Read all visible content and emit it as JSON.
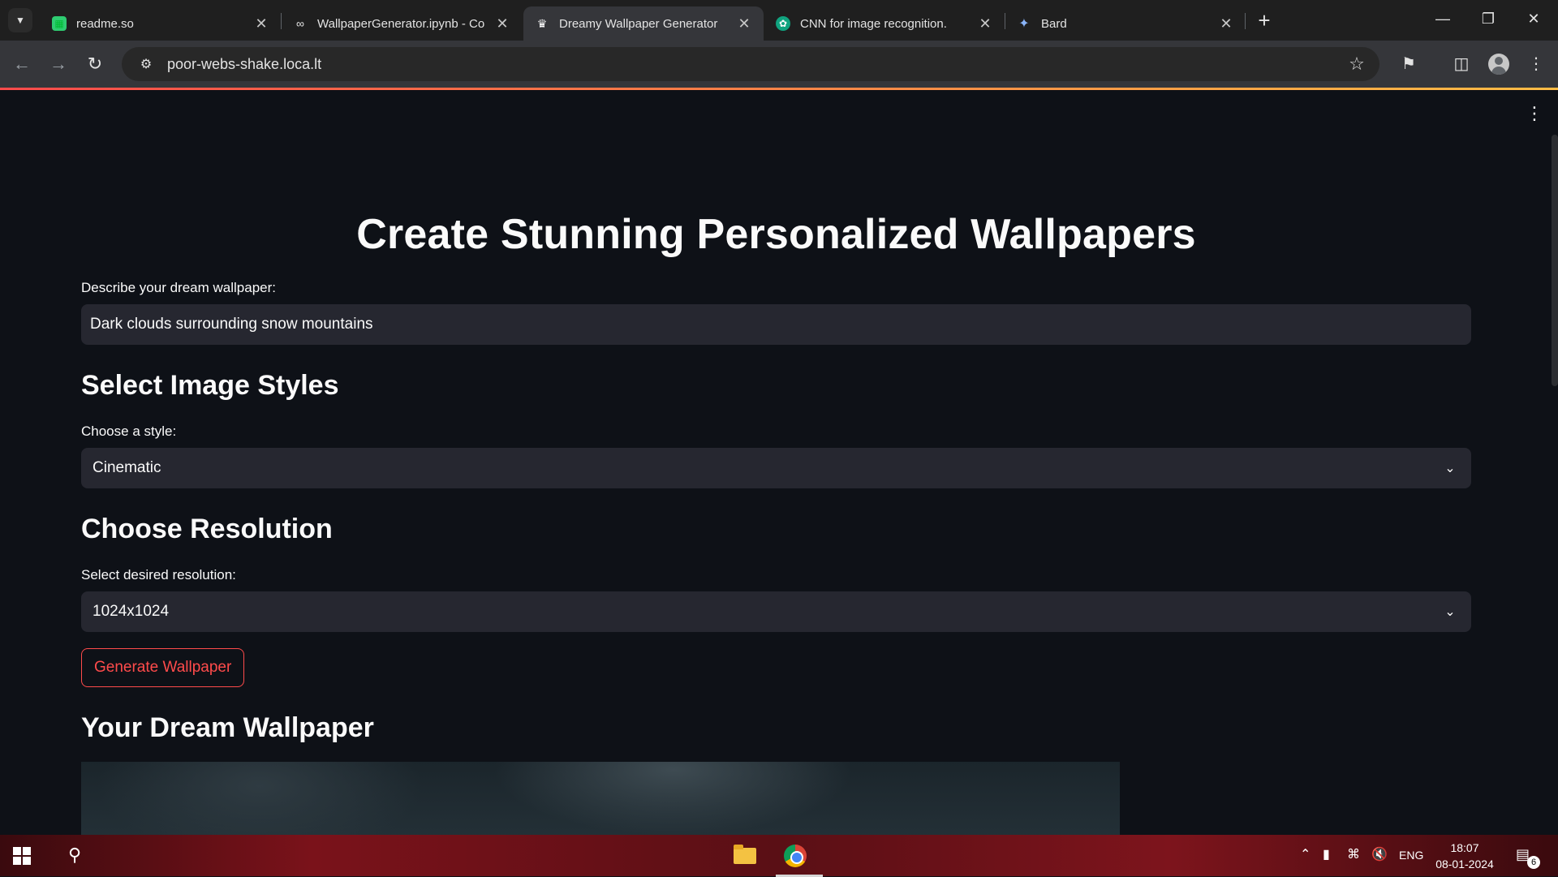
{
  "browser": {
    "tabs": [
      {
        "title": "readme.so",
        "icon": "readme-icon",
        "active": false
      },
      {
        "title": "WallpaperGenerator.ipynb - Co",
        "icon": "colab-icon",
        "active": false
      },
      {
        "title": "Dreamy Wallpaper Generator",
        "icon": "streamlit-crown-icon",
        "active": true
      },
      {
        "title": "CNN for image recognition.",
        "icon": "chatgpt-icon",
        "active": false
      },
      {
        "title": "Bard",
        "icon": "bard-sparkle-icon",
        "active": false
      }
    ],
    "url": "poor-webs-shake.loca.lt",
    "accent_gradient": [
      "#ff4b4b",
      "#ffbd45"
    ]
  },
  "page": {
    "title": "Create Stunning Personalized Wallpapers",
    "prompt_label": "Describe your dream wallpaper:",
    "prompt_value": "Dark clouds surrounding snow mountains",
    "styles_heading": "Select Image Styles",
    "style_label": "Choose a style:",
    "style_value": "Cinematic",
    "resolution_heading": "Choose Resolution",
    "resolution_label": "Select desired resolution:",
    "resolution_value": "1024x1024",
    "generate_button": "Generate Wallpaper",
    "result_heading": "Your Dream Wallpaper",
    "primary_color": "#ff4b4b",
    "background_color": "#0e1117",
    "widget_color": "#262730"
  },
  "taskbar": {
    "language": "ENG",
    "time": "18:07",
    "date": "08-01-2024",
    "notification_count": "6"
  }
}
